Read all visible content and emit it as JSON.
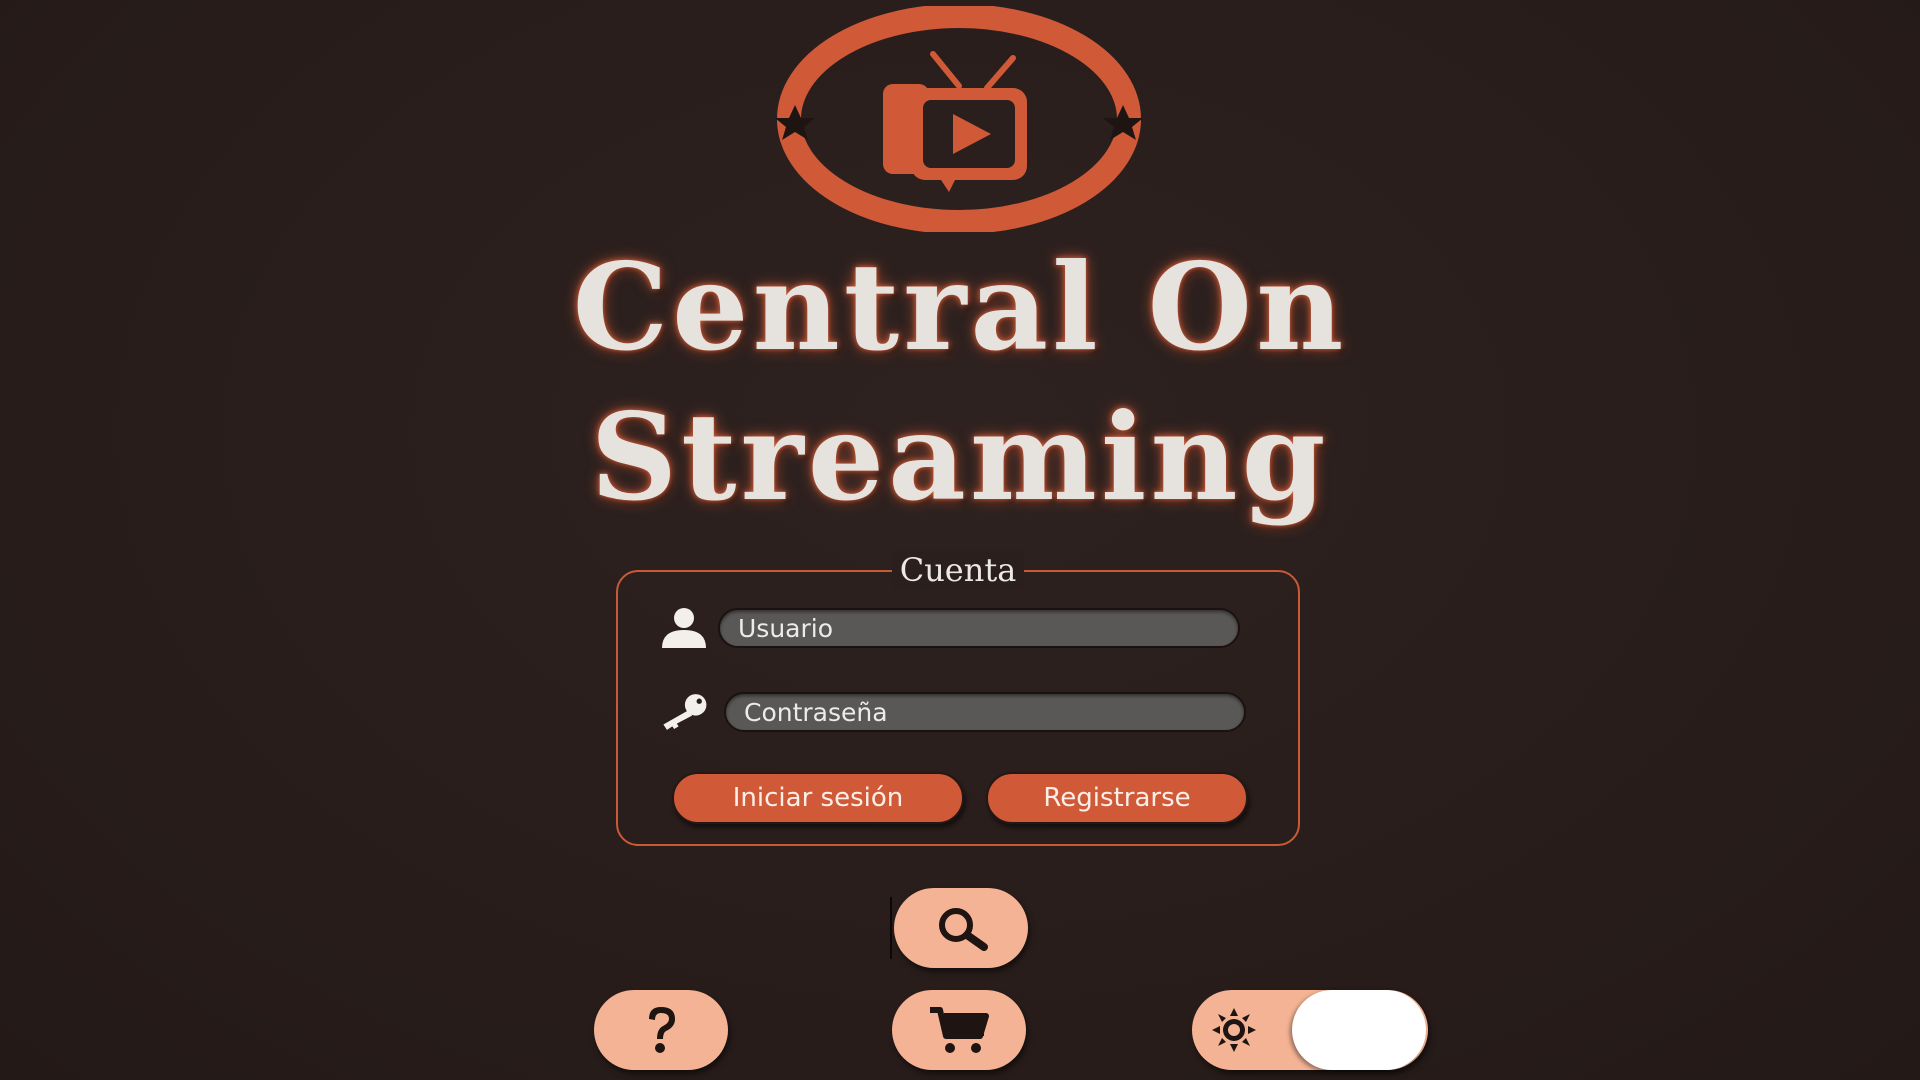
{
  "brand": {
    "title_line1": "Central On",
    "title_line2": "Streaming",
    "accent_color": "#d05a38",
    "logo_icon": "tv-play-icon"
  },
  "account": {
    "legend": "Cuenta",
    "username": {
      "icon": "user-icon",
      "placeholder": "Usuario",
      "value": ""
    },
    "password": {
      "icon": "key-icon",
      "placeholder": "Contraseña",
      "value": ""
    },
    "login_label": "Iniciar sesión",
    "register_label": "Registrarse"
  },
  "controls": {
    "search_icon": "search-icon",
    "help_icon": "question-icon",
    "cart_icon": "cart-icon",
    "theme_icon": "sun-icon",
    "theme_toggle_state": "off"
  }
}
